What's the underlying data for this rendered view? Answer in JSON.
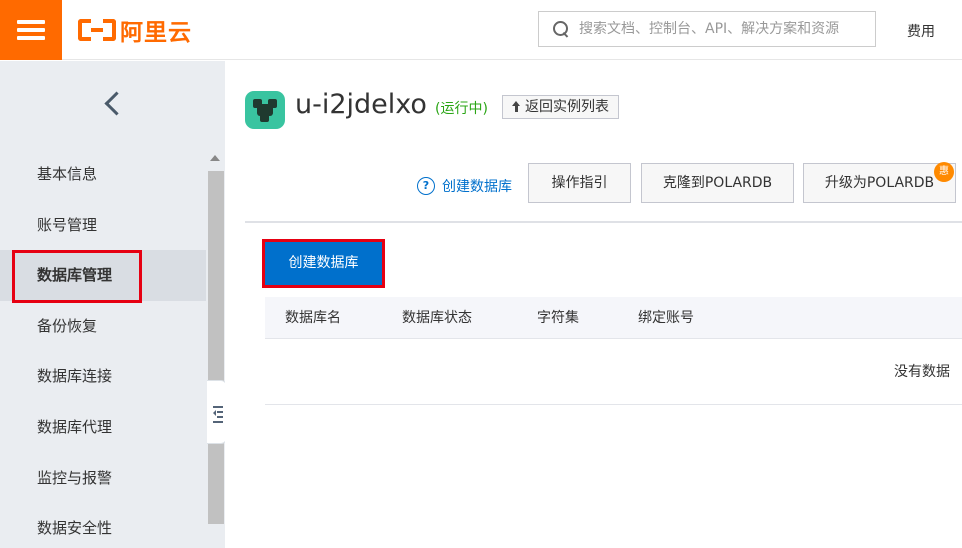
{
  "header": {
    "logo_text": "阿里云",
    "search_placeholder": "搜索文档、控制台、API、解决方案和资源",
    "fee_label": "费用"
  },
  "sidebar": {
    "items": [
      {
        "label": "基本信息"
      },
      {
        "label": "账号管理"
      },
      {
        "label": "数据库管理",
        "active": true
      },
      {
        "label": "备份恢复"
      },
      {
        "label": "数据库连接"
      },
      {
        "label": "数据库代理"
      },
      {
        "label": "监控与报警"
      },
      {
        "label": "数据安全性"
      }
    ]
  },
  "instance": {
    "name": "u-i2jdelxo",
    "status": "(运行中)",
    "back_to_list": "返回实例列表"
  },
  "toolbar": {
    "help_link": "创建数据库",
    "guide_label": "操作指引",
    "clone_label": "克隆到POLARDB",
    "upgrade_label": "升级为POLARDB",
    "promo_badge": "惠"
  },
  "content": {
    "create_button": "创建数据库",
    "table": {
      "columns": [
        "数据库名",
        "数据库状态",
        "字符集",
        "绑定账号"
      ],
      "empty_text": "没有数据"
    }
  },
  "colors": {
    "brand": "#ff6a00",
    "primary": "#0070cc",
    "status_running": "#2aa515",
    "highlight": "#e60012"
  }
}
